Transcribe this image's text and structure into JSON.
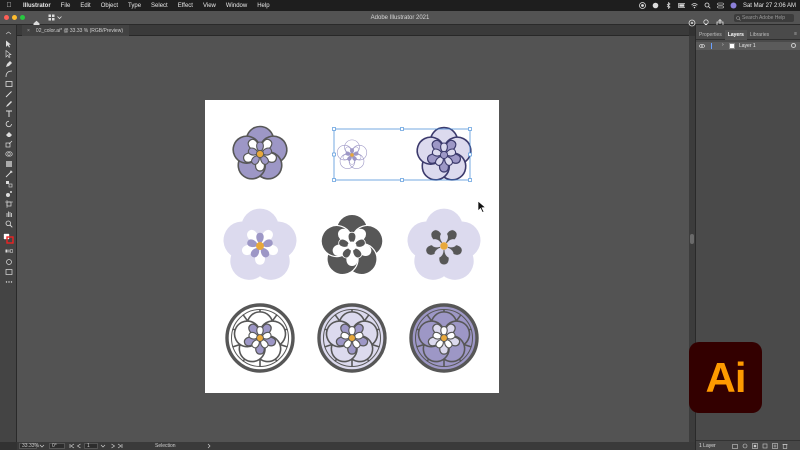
{
  "menubar": {
    "app": "Illustrator",
    "items": [
      "File",
      "Edit",
      "Object",
      "Type",
      "Select",
      "Effect",
      "View",
      "Window",
      "Help"
    ],
    "clock": "Sat Mar 27  2:06 AM"
  },
  "appbar": {
    "title": "Adobe Illustrator 2021",
    "search_placeholder": "Search Adobe Help"
  },
  "document": {
    "tab_label": "02_color.ai* @ 33.33 % (RGB/Preview)"
  },
  "status": {
    "zoom": "33.33%",
    "rotation": "0°",
    "artboard": "1",
    "tool": "Selection"
  },
  "panel": {
    "tabs": [
      "Properties",
      "Layers",
      "Libraries"
    ],
    "active_tab": "Layers",
    "layer_name": "Layer 1",
    "footer_count": "1 Layer"
  },
  "logo": {
    "text": "Ai"
  },
  "colors": {
    "lavender": "#9d97c6",
    "lavender_light": "#dcdaee",
    "dark": "#575757",
    "gold": "#e8a83a",
    "navy": "#3c3a6c",
    "selection": "#3b86d6"
  },
  "artwork": {
    "count": 9,
    "selected": [
      1,
      2
    ]
  }
}
